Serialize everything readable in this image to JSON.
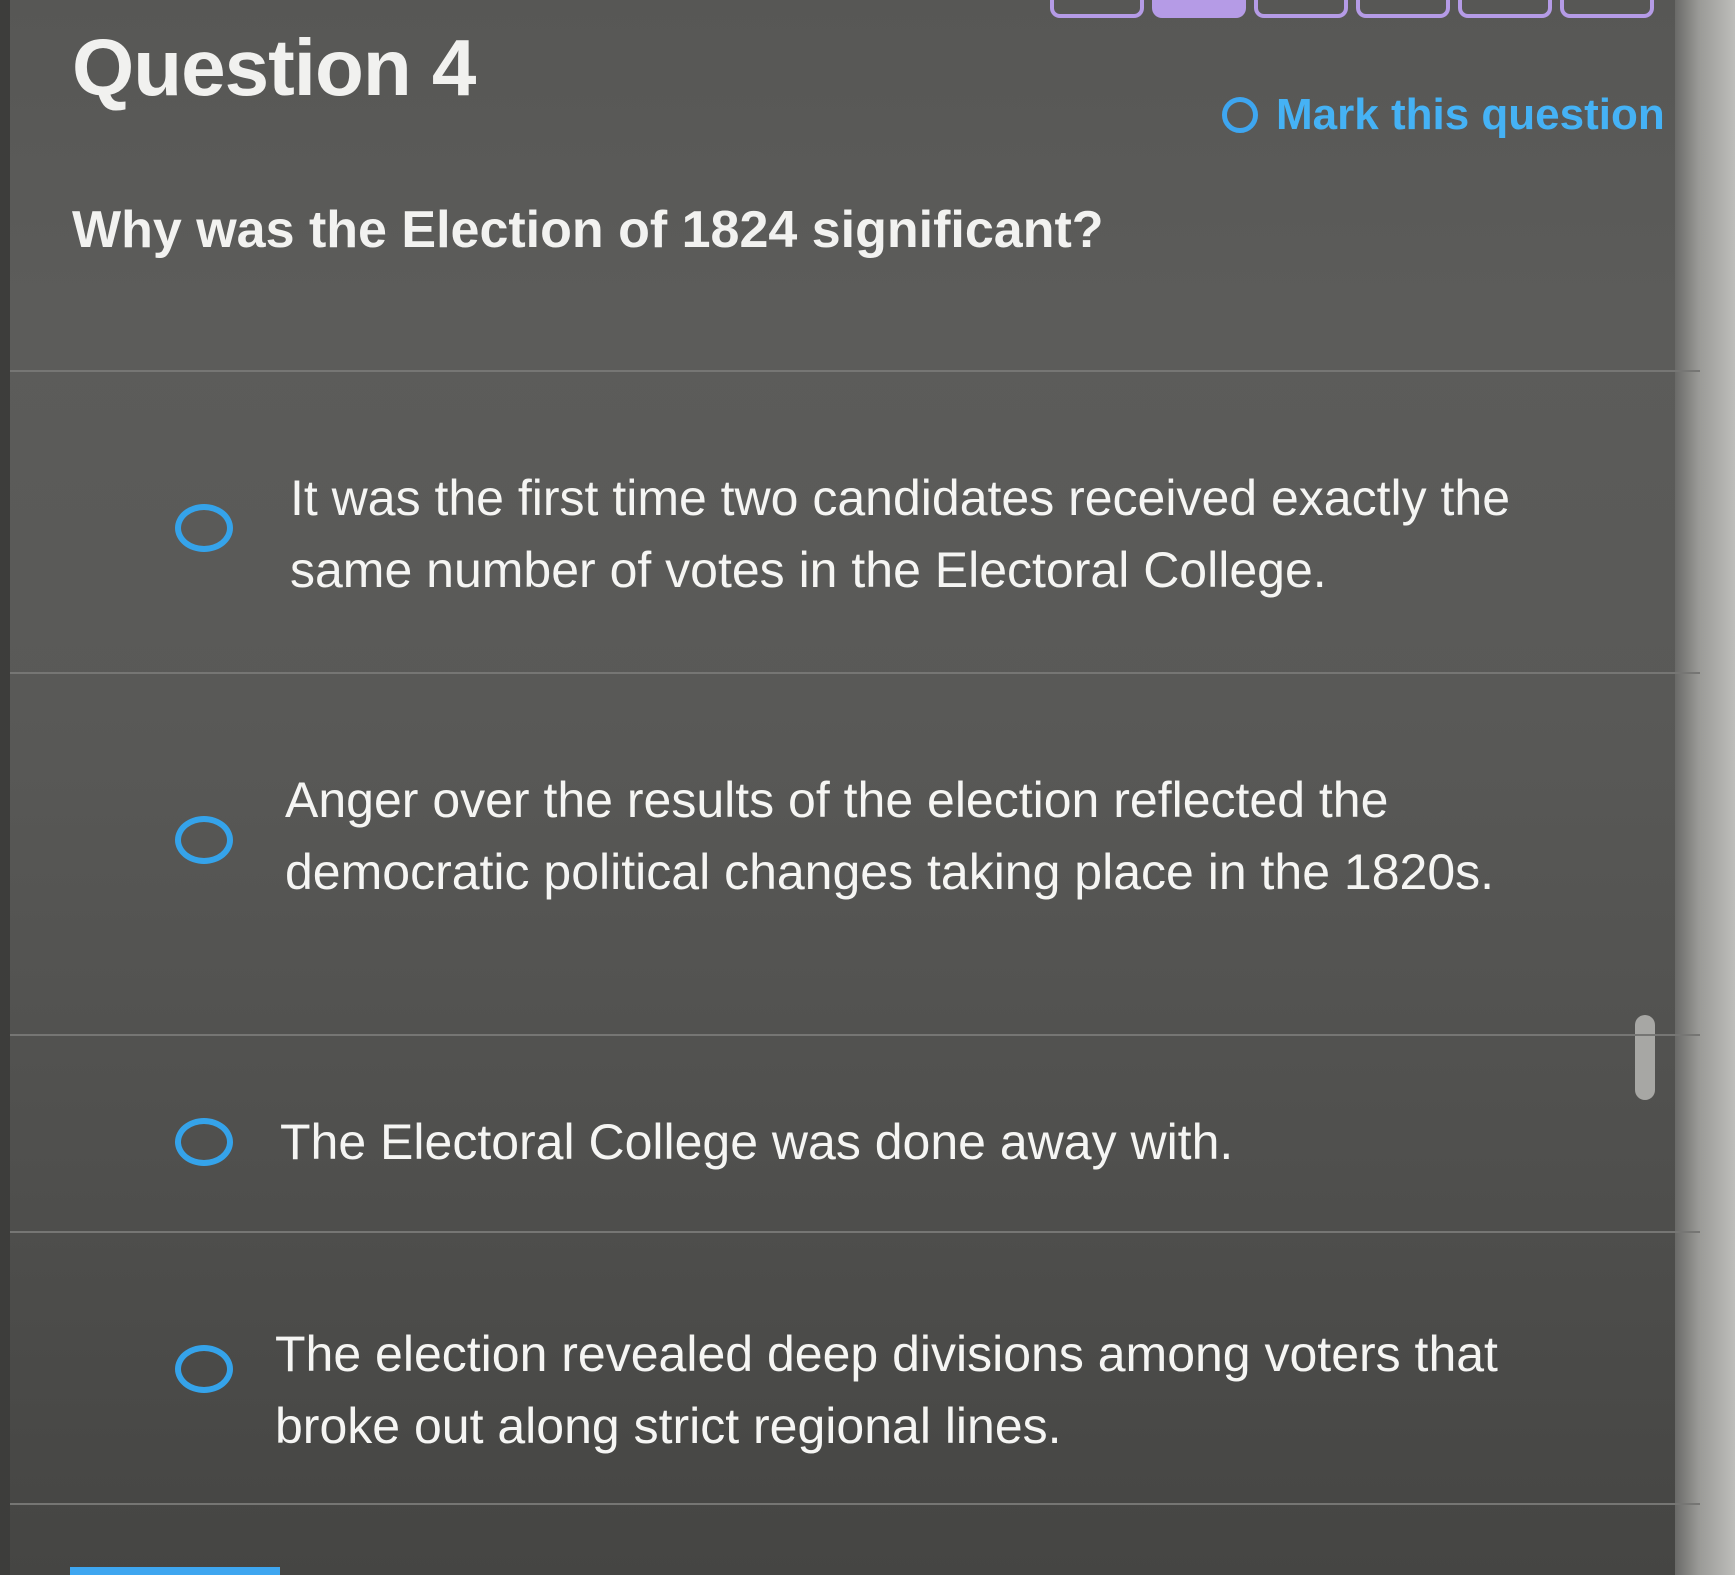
{
  "header": {
    "question_title": "Question 4",
    "mark_label": "Mark this question"
  },
  "question": {
    "text": "Why was the Election of 1824 significant?"
  },
  "answers": [
    {
      "text": "It was the first time two candidates received exactly the same number of votes in the Electoral College."
    },
    {
      "text": "Anger over the results of the election reflected the democratic political changes taking place in the 1820s."
    },
    {
      "text": "The Electoral College was done away with."
    },
    {
      "text": "The election revealed deep divisions among voters that broke out along strict regional lines."
    }
  ],
  "progress": {
    "filled_count": 1,
    "total_visible": 6
  },
  "colors": {
    "accent_blue": "#3ea6f0",
    "progress_purple": "#b59be6",
    "background": "#575755",
    "text": "#f2f2f0"
  }
}
